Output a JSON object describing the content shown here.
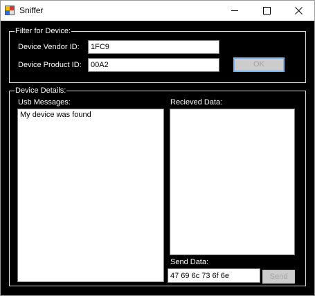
{
  "window": {
    "title": "Sniffer",
    "app_icon": "sniffer-app-icon",
    "controls": {
      "minimize_icon": "minimize-icon",
      "maximize_icon": "maximize-icon",
      "close_icon": "close-icon"
    }
  },
  "filter": {
    "group_label": "Filter for Device:",
    "vendor_label": "Device Vendor ID:",
    "vendor_value": "1FC9",
    "product_label": "Device Product ID:",
    "product_value": "00A2",
    "ok_label": "OK"
  },
  "details": {
    "group_label": "Device Details:",
    "usb_messages_label": "Usb Messages:",
    "usb_messages": [
      "My device was found"
    ],
    "received_label": "Recieved Data:",
    "received_items": [],
    "send_label": "Send Data:",
    "send_value": "47 69 6c 73 6f 6e",
    "send_button_label": "Send"
  },
  "colors": {
    "background": "#000000",
    "text": "#ffffff",
    "disabled_button_bg": "#cccccc",
    "default_button_border": "#7eb4ea"
  }
}
